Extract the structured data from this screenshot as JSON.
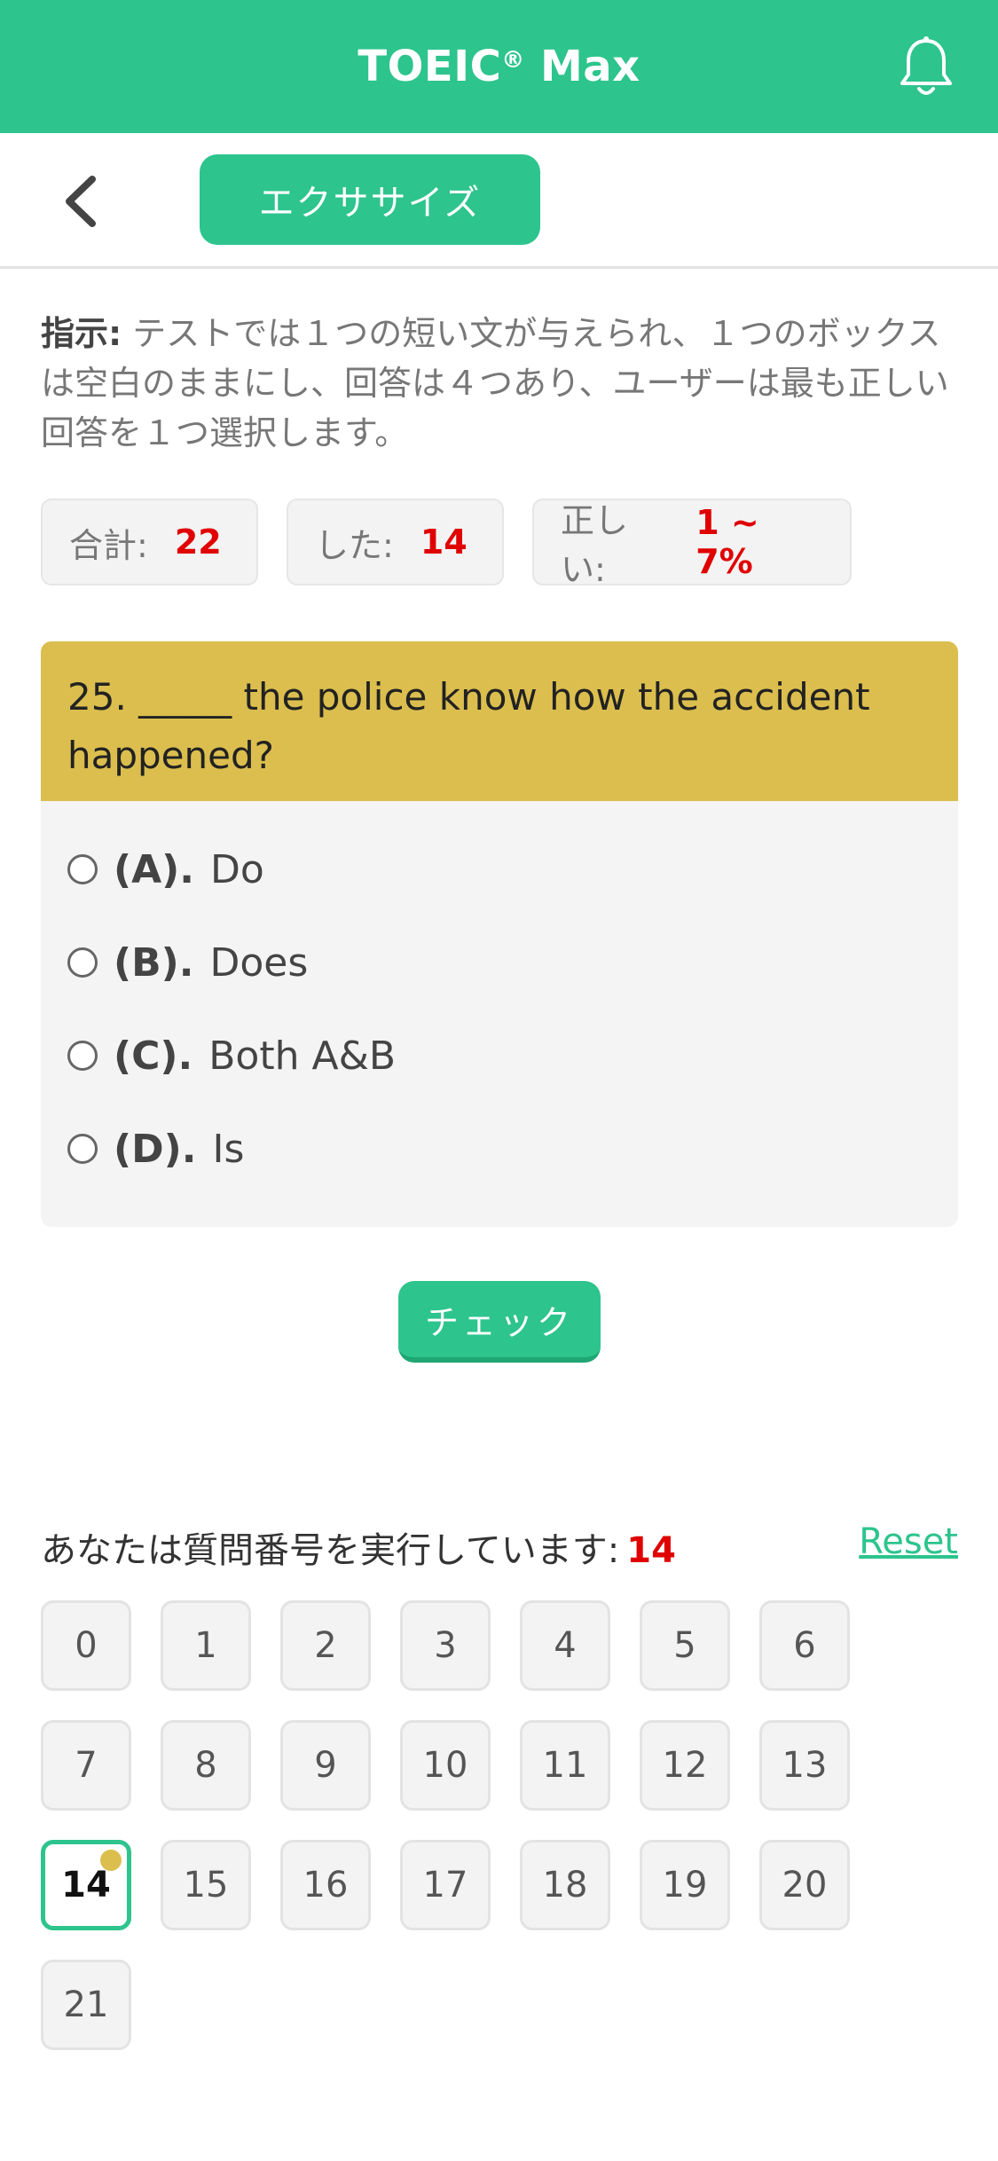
{
  "header": {
    "title": "TOEIC",
    "title_mark": "®",
    "title_suffix": " Max",
    "bell_icon": "bell-icon",
    "brand_color": "#2dc48d"
  },
  "subbar": {
    "back_icon": "chevron-left-icon",
    "exercise_label": "エクササイズ"
  },
  "instruction": {
    "label": "指示:",
    "text": " テストでは１つの短い文が与えられ、１つのボックスは空白のままにし、回答は４つあり、ユーザーは最も正しい回答を１つ選択します。"
  },
  "stats": {
    "total_label": "合計:",
    "total_value": "22",
    "done_label": "した:",
    "done_value": "14",
    "correct_label": "正しい:",
    "correct_value": "1 ~ 7%"
  },
  "question": {
    "text": "25. _____ the police know how the accident happened?",
    "options": [
      {
        "letter": "(A).",
        "text": "Do"
      },
      {
        "letter": "(B).",
        "text": "Does"
      },
      {
        "letter": "(C).",
        "text": "Both A&B"
      },
      {
        "letter": "(D).",
        "text": "Is"
      }
    ]
  },
  "check_label": "チェック",
  "progress": {
    "label": "あなたは質問番号を実行しています:",
    "current": "14",
    "reset_label": "Reset",
    "numbers": [
      "0",
      "1",
      "2",
      "3",
      "4",
      "5",
      "6",
      "7",
      "8",
      "9",
      "10",
      "11",
      "12",
      "13",
      "14",
      "15",
      "16",
      "17",
      "18",
      "19",
      "20",
      "21"
    ]
  }
}
